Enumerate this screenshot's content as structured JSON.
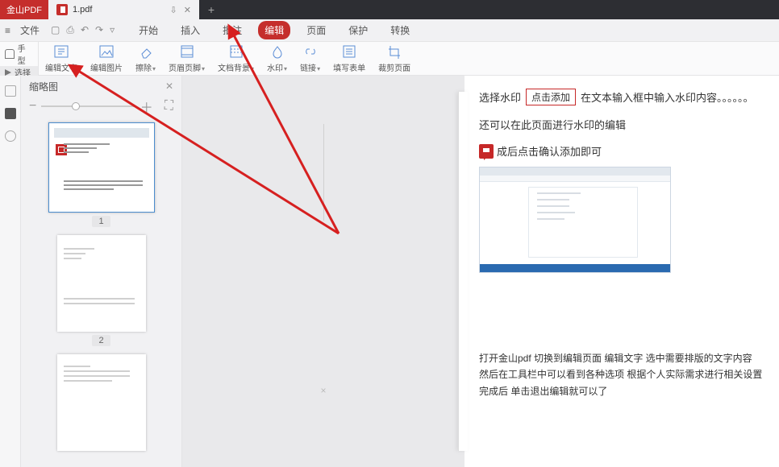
{
  "titlebar": {
    "brand": "金山PDF",
    "tab_label": "1.pdf"
  },
  "menubar": {
    "file": "文件",
    "tabs": [
      {
        "label": "开始"
      },
      {
        "label": "插入"
      },
      {
        "label": "批注"
      },
      {
        "label": "编辑"
      },
      {
        "label": "页面"
      },
      {
        "label": "保护"
      },
      {
        "label": "转换"
      }
    ],
    "active_tab_index": 3
  },
  "side_tools": {
    "hand": "手型",
    "select": "选择"
  },
  "toolbar": [
    {
      "label": "编辑文字",
      "icon": "edit-text-icon"
    },
    {
      "label": "编辑图片",
      "icon": "edit-image-icon"
    },
    {
      "label": "擦除",
      "icon": "erase-icon",
      "caret": true
    },
    {
      "label": "页眉页脚",
      "icon": "header-footer-icon",
      "caret": true
    },
    {
      "label": "文档背景",
      "icon": "background-icon",
      "caret": true
    },
    {
      "label": "水印",
      "icon": "watermark-icon",
      "caret": true
    },
    {
      "label": "链接",
      "icon": "link-icon",
      "caret": true
    },
    {
      "label": "填写表单",
      "icon": "form-icon"
    },
    {
      "label": "裁剪页面",
      "icon": "crop-icon"
    }
  ],
  "thumbs": {
    "title": "缩略图",
    "pages": [
      "1",
      "2"
    ]
  },
  "canvas_center": "×",
  "rightpane": {
    "r1_a": "选择水印",
    "add_button": "点击添加",
    "r1_b": "在文本输入框中输入水印内容。。。。。。",
    "r2": "还可以在此页面进行水印的编辑",
    "r3": "成后点击确认添加即可",
    "para1": "打开金山pdf    切换到编辑页面    编辑文字    选中需要排版的文字内容",
    "para2": "然后在工具栏中可以看到各种选项    根据个人实际需求进行相关设置",
    "para3": "完成后    单击退出编辑就可以了"
  }
}
